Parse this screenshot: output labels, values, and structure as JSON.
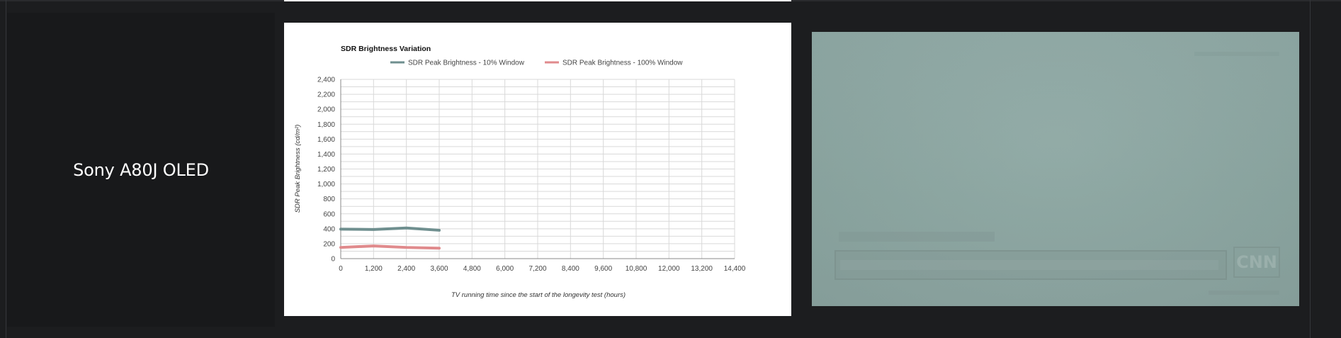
{
  "row": {
    "tv_name": "Sony A80J OLED"
  },
  "chart_data": {
    "type": "line",
    "title": "SDR Brightness Variation",
    "xlabel": "TV running time since the start of the longevity test (hours)",
    "ylabel": "SDR Peak Brightness (cd/m²)",
    "x_ticks": [
      "0",
      "1,200",
      "2,400",
      "3,600",
      "4,800",
      "6,000",
      "7,200",
      "8,400",
      "9,600",
      "10,800",
      "12,000",
      "13,200",
      "14,400"
    ],
    "y_ticks": [
      "0",
      "200",
      "400",
      "600",
      "800",
      "1,000",
      "1,200",
      "1,400",
      "1,600",
      "1,800",
      "2,000",
      "2,200",
      "2,400"
    ],
    "xlim": [
      0,
      14400
    ],
    "ylim": [
      0,
      2400
    ],
    "legend_position": "top",
    "grid": true,
    "series": [
      {
        "name": "SDR Peak Brightness - 10% Window",
        "color": "#6f8f8f",
        "x": [
          0,
          1200,
          2400,
          3600
        ],
        "values": [
          395,
          390,
          410,
          380
        ]
      },
      {
        "name": "SDR Peak Brightness - 100% Window",
        "color": "#e08a8c",
        "x": [
          0,
          1200,
          2400,
          3600
        ],
        "values": [
          150,
          170,
          150,
          140
        ]
      }
    ]
  },
  "photo": {
    "logo_text": "CNN"
  }
}
